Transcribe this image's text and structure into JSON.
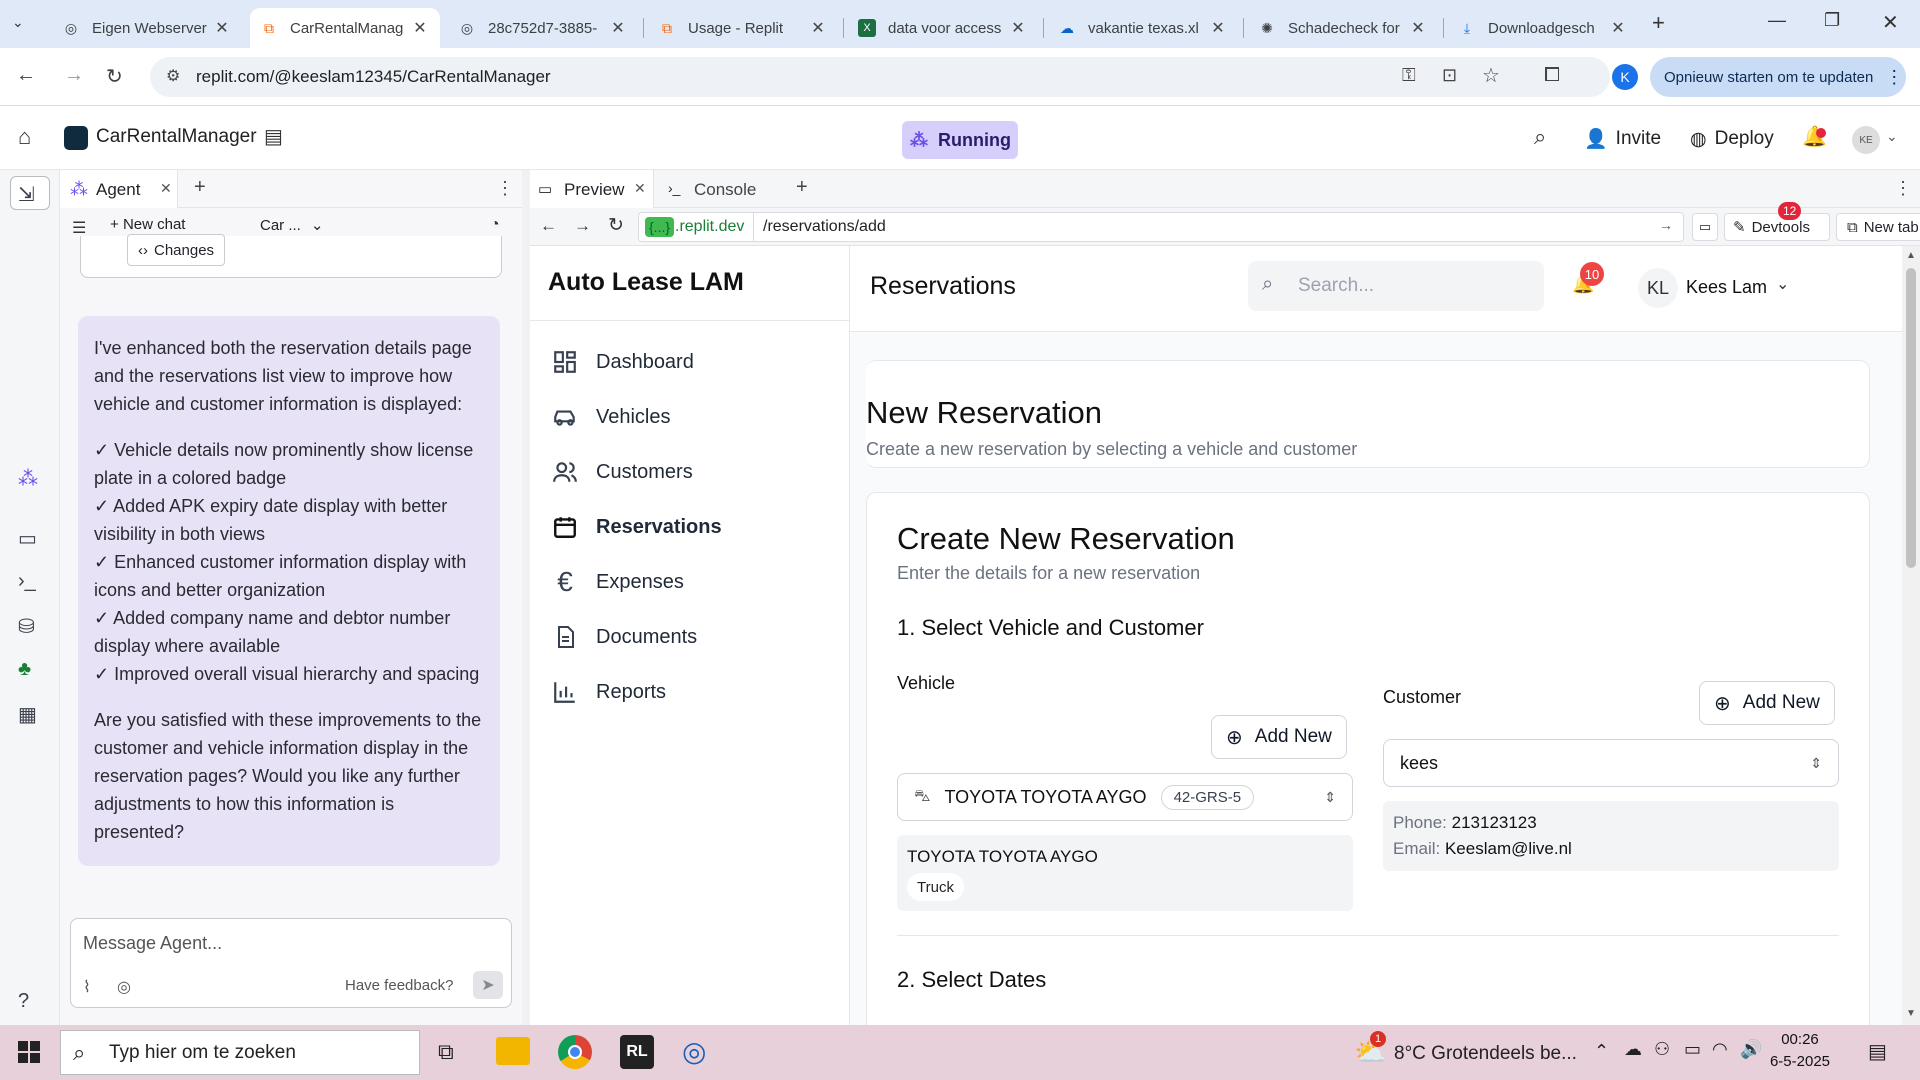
{
  "browser": {
    "tabs": [
      {
        "title": "Eigen Webserver",
        "icon": "globe-icon"
      },
      {
        "title": "CarRentalManag",
        "icon": "replit-icon"
      },
      {
        "title": "28c752d7-3885-",
        "icon": "globe-icon"
      },
      {
        "title": "Usage - Replit",
        "icon": "replit-icon"
      },
      {
        "title": "data voor access",
        "icon": "excel-icon"
      },
      {
        "title": "vakantie texas.xl",
        "icon": "onedrive-icon"
      },
      {
        "title": "Schadecheck for",
        "icon": "openai-icon"
      },
      {
        "title": "Downloadgesch",
        "icon": "download-icon"
      }
    ],
    "url": "replit.com/@keeslam12345/CarRentalManager",
    "update_label": "Opnieuw starten om te updaten",
    "profile_initial": "K"
  },
  "replit": {
    "project": "CarRentalManager",
    "status": "Running",
    "invite": "Invite",
    "deploy": "Deploy",
    "avatar": "KE"
  },
  "agent": {
    "tab_label": "Agent",
    "new_chat": "New chat",
    "model": "Car ...",
    "changes_label": "Changes",
    "intro": "I've enhanced both the reservation details page and the reservations list view to improve how vehicle and customer information is displayed:",
    "items": [
      "✓ Vehicle details now prominently show license plate in a colored badge",
      "✓ Added APK expiry date display with better visibility in both views",
      "✓ Enhanced customer information display with icons and better organization",
      "✓ Added company name and debtor number display where available",
      "✓ Improved overall visual hierarchy and spacing"
    ],
    "question": "Are you satisfied with these improvements to the customer and vehicle information display in the reservation pages? Would you like any further adjustments to how this information is presented?",
    "input_placeholder": "Message Agent...",
    "feedback": "Have feedback?"
  },
  "preview": {
    "tab_preview": "Preview",
    "tab_console": "Console",
    "domain_chip": "{...}",
    "domain": ".replit.dev",
    "path": "/reservations/add",
    "devtools": "Devtools",
    "devtools_badge": "12",
    "new_tab": "New tab"
  },
  "site": {
    "brand": "Auto Lease LAM",
    "nav": [
      {
        "label": "Dashboard",
        "icon": "dashboard-icon",
        "active": false
      },
      {
        "label": "Vehicles",
        "icon": "car-icon",
        "active": false
      },
      {
        "label": "Customers",
        "icon": "users-icon",
        "active": false
      },
      {
        "label": "Reservations",
        "icon": "calendar-icon",
        "active": true
      },
      {
        "label": "Expenses",
        "icon": "euro-icon",
        "active": false
      },
      {
        "label": "Documents",
        "icon": "document-icon",
        "active": false
      },
      {
        "label": "Reports",
        "icon": "chart-icon",
        "active": false
      }
    ],
    "header_title": "Reservations",
    "search_placeholder": "Search...",
    "notif_count": "10",
    "user_initials": "KL",
    "user_name": "Kees Lam",
    "page_title": "New Reservation",
    "page_subtitle": "Create a new reservation by selecting a vehicle and customer",
    "form_title": "Create New Reservation",
    "form_subtitle": "Enter the details for a new reservation",
    "step1": "1. Select Vehicle and Customer",
    "vehicle_label": "Vehicle",
    "add_new": "Add New",
    "vehicle_value": "TOYOTA TOYOTA AYGO",
    "vehicle_plate": "42-GRS-5",
    "vehicle_detail_name": "TOYOTA TOYOTA AYGO",
    "vehicle_detail_type": "Truck",
    "customer_label": "Customer",
    "customer_value": "kees",
    "phone_label": "Phone:",
    "phone_value": "213123123",
    "email_label": "Email:",
    "email_value": "Keeslam@live.nl",
    "step2": "2. Select Dates"
  },
  "taskbar": {
    "search_placeholder": "Typ hier om te zoeken",
    "weather": "8°C  Grotendeels be...",
    "weather_badge": "1",
    "time": "00:26",
    "date": "6-5-2025"
  }
}
